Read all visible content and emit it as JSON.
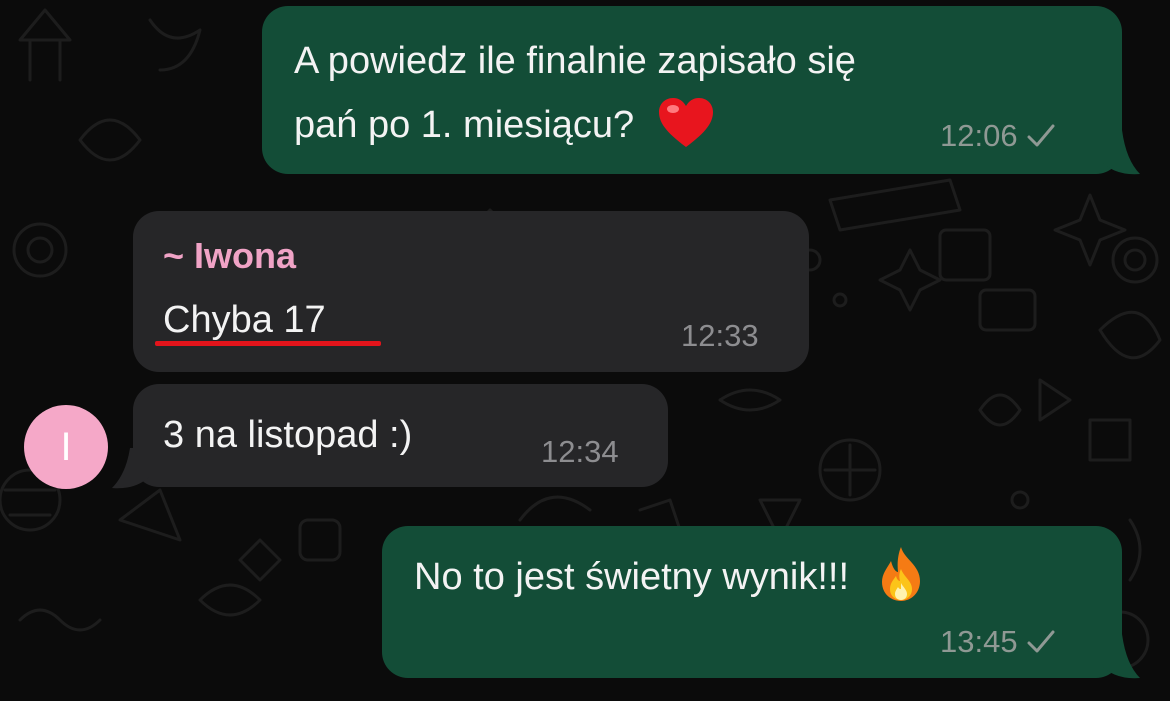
{
  "chat": {
    "messages": [
      {
        "direction": "outgoing",
        "text_line1": "A powiedz ile finalnie zapisało się",
        "text_line2": "pań po 1. miesiącu?",
        "emoji": "heart-emoji",
        "time": "12:06",
        "status": "sent-check"
      },
      {
        "direction": "incoming",
        "sender": "~ Iwona",
        "text": "Chyba 17",
        "time": "12:33",
        "highlight": "red-underline"
      },
      {
        "direction": "incoming",
        "text": "3 na listopad :)",
        "time": "12:34"
      },
      {
        "direction": "outgoing",
        "text": "No to jest świetny wynik!!!",
        "emoji": "fire-emoji",
        "time": "13:45",
        "status": "sent-check"
      }
    ],
    "avatar_initial": "I"
  },
  "colors": {
    "background": "#0b0b0b",
    "outgoing_bubble": "#134d37",
    "incoming_bubble": "#262628",
    "sender_name": "#f0a3c6",
    "avatar": "#f5a8c8",
    "underline": "#e3141b"
  }
}
